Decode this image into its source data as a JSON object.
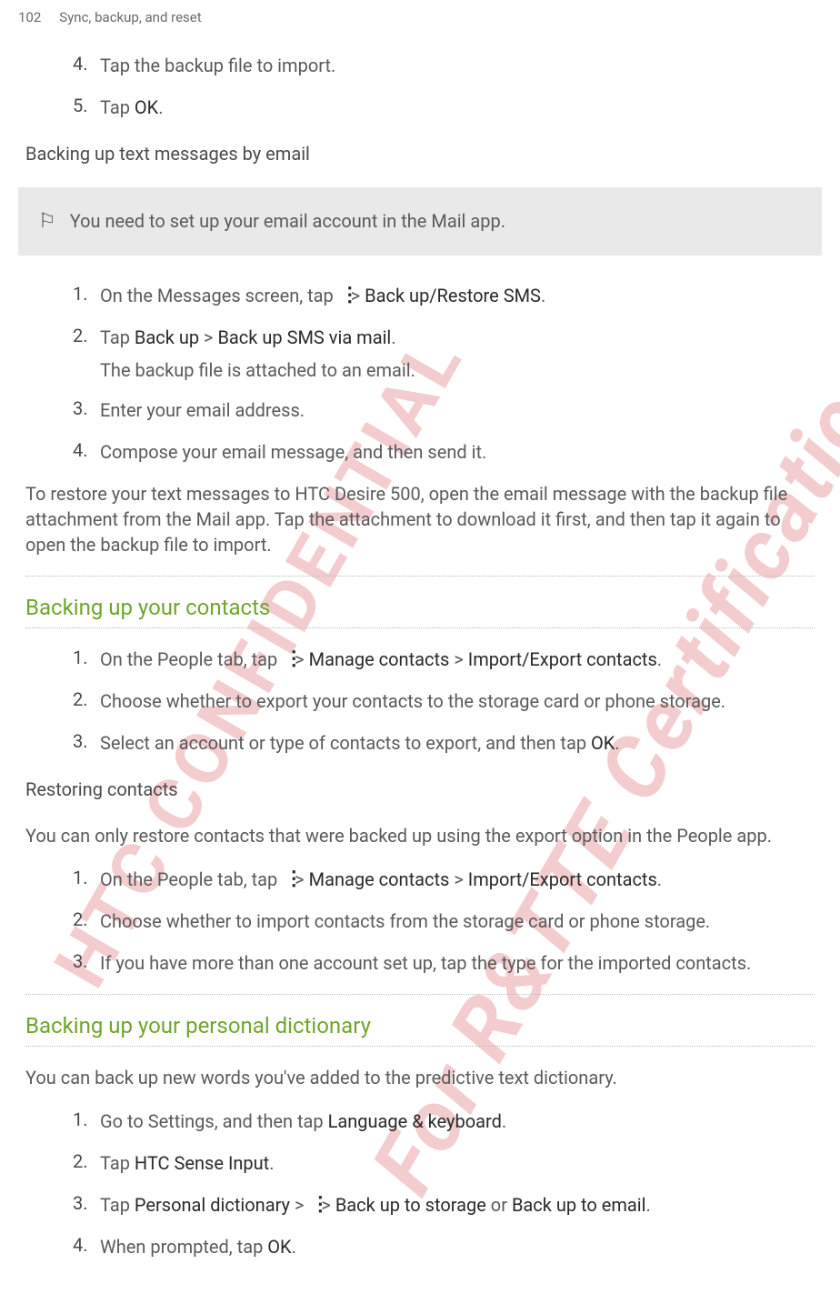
{
  "header": {
    "page_number": "102",
    "section": "Sync, backup, and reset"
  },
  "watermarks": {
    "confidential": "HTC CONFIDENTIAL",
    "certification": "For R&TTE Certification only"
  },
  "top_steps": {
    "s4": {
      "num": "4.",
      "text": "Tap the backup file to import."
    },
    "s5": {
      "num": "5.",
      "prefix": "Tap ",
      "bold": "OK",
      "suffix": "."
    }
  },
  "backing_sms_email": {
    "title": "Backing up text messages by email",
    "note": "You need to set up your email account in the Mail app.",
    "s1": {
      "num": "1.",
      "prefix": "On the Messages screen, tap ",
      "suffix": " > ",
      "bold": "Back up/Restore SMS",
      "end": "."
    },
    "s2": {
      "num": "2.",
      "prefix": "Tap ",
      "bold1": "Back up",
      "mid": " > ",
      "bold2": "Back up SMS via mail",
      "suffix": "."
    },
    "s2sub": "The backup file is attached to an email.",
    "s3": {
      "num": "3.",
      "text": "Enter your email address."
    },
    "s4": {
      "num": "4.",
      "text": "Compose your email message, and then send it."
    },
    "restore_para": "To restore your text messages to HTC Desire 500, open the email message with the backup file attachment from the Mail app. Tap the attachment to download it first, and then tap it again to open the backup file to import."
  },
  "backup_contacts": {
    "title": "Backing up your contacts",
    "s1": {
      "num": "1.",
      "prefix": "On the People tab, tap ",
      "mid": " > ",
      "bold1": "Manage contacts",
      "mid2": " > ",
      "bold2": "Import/Export contacts",
      "suffix": "."
    },
    "s2": {
      "num": "2.",
      "text": "Choose whether to export your contacts to the storage card or phone storage."
    },
    "s3": {
      "num": "3.",
      "prefix": "Select an account or type of contacts to export, and then tap ",
      "bold": "OK",
      "suffix": "."
    }
  },
  "restoring_contacts": {
    "title": "Restoring contacts",
    "intro": "You can only restore contacts that were backed up using the export option in the People app.",
    "s1": {
      "num": "1.",
      "prefix": "On the People tab, tap ",
      "mid": " > ",
      "bold1": "Manage contacts",
      "mid2": " > ",
      "bold2": "Import/Export contacts",
      "suffix": "."
    },
    "s2": {
      "num": "2.",
      "text": "Choose whether to import contacts from the storage card or phone storage."
    },
    "s3": {
      "num": "3.",
      "text": "If you have more than one account set up, tap the type for the imported contacts."
    }
  },
  "backup_dictionary": {
    "title": "Backing up your personal dictionary",
    "intro": "You can back up new words you've added to the predictive text dictionary.",
    "s1": {
      "num": "1.",
      "prefix": "Go to Settings, and then tap ",
      "bold": "Language & keyboard",
      "suffix": "."
    },
    "s2": {
      "num": "2.",
      "prefix": "Tap ",
      "bold": "HTC Sense Input",
      "suffix": "."
    },
    "s3": {
      "num": "3.",
      "prefix": "Tap ",
      "bold1": "Personal dictionary",
      "mid": " > ",
      "mid2": " > ",
      "bold2": "Back up to storage",
      "or": " or ",
      "bold3": "Back up to email",
      "suffix": "."
    },
    "s4": {
      "num": "4.",
      "prefix": "When prompted, tap ",
      "bold": "OK",
      "suffix": "."
    }
  }
}
